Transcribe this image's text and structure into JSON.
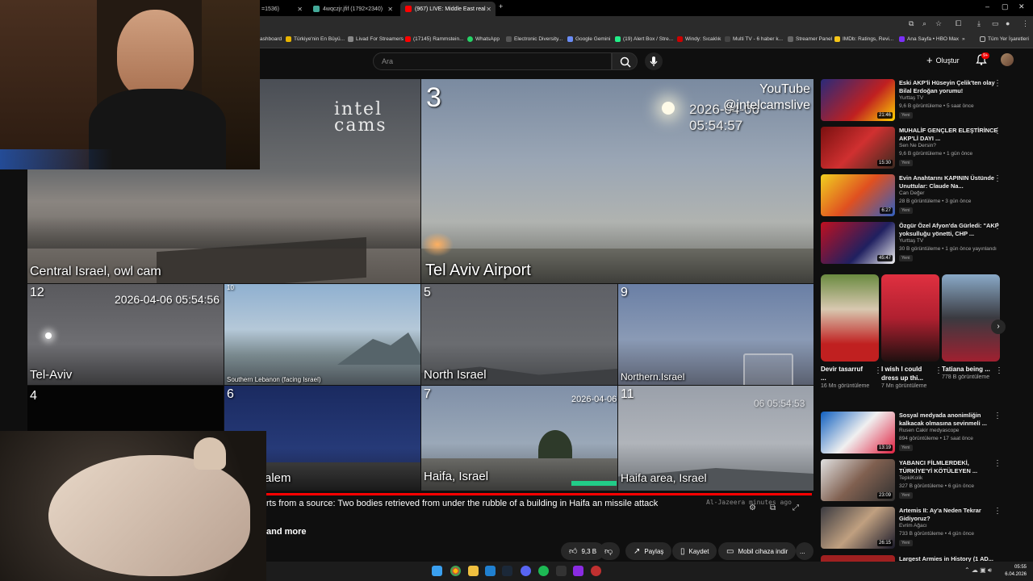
{
  "browser": {
    "tabs": [
      {
        "label": "=1536)",
        "active": false
      },
      {
        "label": "4wqczjr.jfif (1792×2340)",
        "active": false
      },
      {
        "label": "(967) LIVE: Middle East real",
        "active": true
      }
    ],
    "bookmarks": [
      "ashboard",
      "Türkiye'nin En Büyü...",
      "Livad For Streamers",
      "(17145) Rammstein...",
      "WhatsApp",
      "Electronic Diversity...",
      "Google Gemini",
      "(19) Alert Box / Stre...",
      "Windy: Sıcaklık",
      "Multi TV - 6 haber k...",
      "Streamer Panel",
      "IMDb: Ratings, Revi...",
      "Ana Sayfa • HBO Max",
      "»",
      "Tüm Yer İşaretleri"
    ]
  },
  "header": {
    "search_placeholder": "Ara",
    "create_label": "Oluştur",
    "notif_count": "9+"
  },
  "player": {
    "watermark_youtube": "YouTube",
    "watermark_handle": "@intelcamslive",
    "intel_logo_1": "intel",
    "intel_logo_2": "cams",
    "cams": [
      {
        "num": "",
        "label": "Central Israel, owl cam",
        "time": ""
      },
      {
        "num": "3",
        "label": "Tel Aviv Airport",
        "time": "2026-04-06 05:54:57"
      },
      {
        "num": "12",
        "label": "Tel-Aviv",
        "time": "2026-04-06 05:54:56"
      },
      {
        "num": "10",
        "label": "Southern Lebanon (facing Israel)",
        "time": ""
      },
      {
        "num": "5",
        "label": "North Israel",
        "time": ""
      },
      {
        "num": "9",
        "label": "Northern.Israel",
        "time": ""
      },
      {
        "num": "4",
        "label": "",
        "time": ""
      },
      {
        "num": "6",
        "label": "alem",
        "time": ""
      },
      {
        "num": "7",
        "label": "Haifa, Israel",
        "time": "2026-04-06"
      },
      {
        "num": "11",
        "label": "Haifa area, Israel",
        "time": "06 05:54:53"
      }
    ]
  },
  "ticker": {
    "text": "rts from a source: Two bodies retrieved from under the rubble of a building in Haifa an missile attack",
    "source": "Al-Jazeera minutes ago",
    "and_more": "and more"
  },
  "actions": {
    "likes": "9,3 B",
    "share": "Paylaş",
    "save": "Kaydet",
    "download": "Mobil cihaza indir",
    "more": "..."
  },
  "recommendations": [
    {
      "title": "Eski AKP'li Hüseyin Çelik'ten olay Bilal Erdoğan yorumu!",
      "channel": "Yurttaş TV",
      "meta": "9,6 B görüntüleme • 5 saat önce",
      "badge": "Yeni",
      "duration": "21:46"
    },
    {
      "title": "MUHALİF GENÇLER ELEŞTİRİNCE AKP'Lİ DAYI ...",
      "channel": "Sen Ne Dersin?",
      "meta": "9,6 B görüntüleme • 1 gün önce",
      "badge": "Yeni",
      "duration": "15:30"
    },
    {
      "title": "Evin Anahtarını KAPININ Üstünde Unuttular: Claude Na...",
      "channel": "Can Değer",
      "meta": "28 B görüntüleme • 3 gün önce",
      "badge": "Yeni",
      "duration": "6:27"
    },
    {
      "title": "Özgür Özel Afyon'da Gürledi: \"AKP yoksulluğu yönetti, CHP ...",
      "channel": "Yurttaş TV",
      "meta": "30 B görüntüleme • 1 gün önce yayınlandı",
      "badge": "Yeni",
      "duration": "45:47"
    }
  ],
  "shorts": [
    {
      "title": "Devir tasarruf ...",
      "views": "16 Mn görüntüleme"
    },
    {
      "title": "I wish I could dress up thi...",
      "views": "7 Mn görüntüleme"
    },
    {
      "title": "Tatiana being ...",
      "views": "778 B görüntüleme"
    }
  ],
  "recommendations2": [
    {
      "title": "Sosyal medyada anonimliğin kalkacak olmasına sevinmeli ...",
      "channel": "Rusen Cakir medyascope",
      "meta": "894 görüntüleme • 17 saat önce",
      "badge": "Yeni",
      "duration": "13:19"
    },
    {
      "title": "YABANCI FİLMLERDEKİ, TÜRKİYE'Yİ KÖTÜLEYEN ...",
      "channel": "TepkiKolik",
      "meta": "327 B görüntüleme • 6 gün önce",
      "badge": "Yeni",
      "duration": "23:09"
    },
    {
      "title": "Artemis II: Ay'a Neden Tekrar Gidiyoruz?",
      "channel": "Evrim Ağacı",
      "meta": "733 B görüntüleme • 4 gün önce",
      "badge": "Yeni",
      "duration": "26:15"
    },
    {
      "title": "Largest Armies in History (1 AD...",
      "channel": "",
      "meta": "",
      "badge": "",
      "duration": ""
    }
  ],
  "taskbar": {
    "time": "05:55",
    "date": "6.04.2026"
  }
}
